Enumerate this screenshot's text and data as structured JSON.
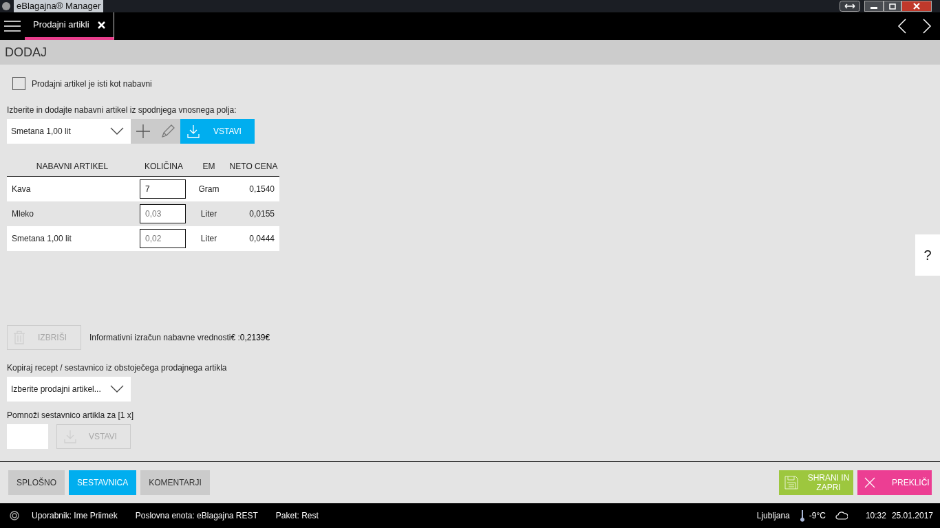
{
  "window": {
    "title": "eBlagajna® Manager"
  },
  "tabs": [
    {
      "label": "Prodajni artikli",
      "selected": true
    }
  ],
  "heading": "DODAJ",
  "same_as_purchase": {
    "label": "Prodajni artikel je isti kot nabavni",
    "checked": false
  },
  "add_section": {
    "label": "Izberite in dodajte nabavni artikel iz spodnjega vnosnega polja:",
    "select_value": "Smetana 1,00 lit",
    "insert_button": "VSTAVI"
  },
  "table": {
    "columns": [
      "NABAVNI ARTIKEL",
      "KOLIČINA",
      "EM",
      "NETO CENA"
    ],
    "rows": [
      {
        "article": "Kava",
        "quantity": "7",
        "unit": "Gram",
        "net_price": "0,1540",
        "focused": true
      },
      {
        "article": "Mleko",
        "quantity": "0,03",
        "unit": "Liter",
        "net_price": "0,0155",
        "focused": false
      },
      {
        "article": "Smetana 1,00 lit",
        "quantity": "0,02",
        "unit": "Liter",
        "net_price": "0,0444",
        "focused": false
      }
    ]
  },
  "delete_button": {
    "label": "IZBRIŠI",
    "disabled": true
  },
  "info": {
    "label": "Informativni izračun nabavne vrednosti€ :",
    "value": "0,2139€"
  },
  "copy_section": {
    "label": "Kopiraj recept / sestavnico iz obstoječega prodajnega artikla",
    "placeholder": "Izberite prodajni artikel..."
  },
  "multiply": {
    "label": "Pomnoži sestavnico artikla za [1 x]",
    "button": {
      "label": "VSTAVI",
      "disabled": true
    }
  },
  "help_button": "?",
  "bottom_tabs": [
    {
      "label": "SPLOŠNO",
      "selected": false
    },
    {
      "label": "SESTAVNICA",
      "selected": true
    },
    {
      "label": "KOMENTARJI",
      "selected": false
    }
  ],
  "actions": [
    {
      "label": "SHRANI IN ZAPRI",
      "kind": "save"
    },
    {
      "label": "PREKLIČI",
      "kind": "cancel"
    }
  ],
  "status_bar": {
    "user": "Uporabnik: Ime Priimek",
    "unit": "Poslovna enota: eBlagajna REST",
    "package": "Paket: Rest",
    "city": "Ljubljana",
    "temperature": "-9°C",
    "time": "10:32",
    "date": "25.01.2017"
  }
}
